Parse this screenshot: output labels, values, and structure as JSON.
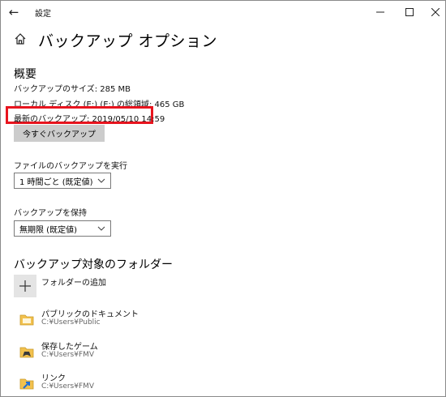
{
  "window": {
    "title": "設定"
  },
  "page": {
    "title": "バックアップ オプション"
  },
  "overview": {
    "heading": "概要",
    "backup_size": "バックアップのサイズ: 285 MB",
    "total_space": "ローカル ディスク (E:) (E:) の総領域: 465 GB",
    "latest_backup": "最新のバックアップ: 2019/05/10 14:59",
    "backup_now_label": "今すぐバックアップ"
  },
  "run_backup": {
    "label": "ファイルのバックアップを実行",
    "selected": "1 時間ごと (既定値)"
  },
  "keep_backup": {
    "label": "バックアップを保持",
    "selected": "無期限 (既定値)"
  },
  "folders": {
    "heading": "バックアップ対象のフォルダー",
    "add_label": "フォルダーの追加",
    "items": [
      {
        "name": "パブリックのドキュメント",
        "path": "C:¥Users¥Public",
        "icon": "folder-icon"
      },
      {
        "name": "保存したゲーム",
        "path": "C:¥Users¥FMV",
        "icon": "saved-games-icon"
      },
      {
        "name": "リンク",
        "path": "C:¥Users¥FMV",
        "icon": "links-folder-icon"
      }
    ]
  },
  "colors": {
    "highlight": "#e8141e",
    "button_bg": "#cccccc",
    "add_tile_bg": "#e4e4e4",
    "folder_yellow": "#f2c14e",
    "link_blue": "#1e6fd9"
  }
}
